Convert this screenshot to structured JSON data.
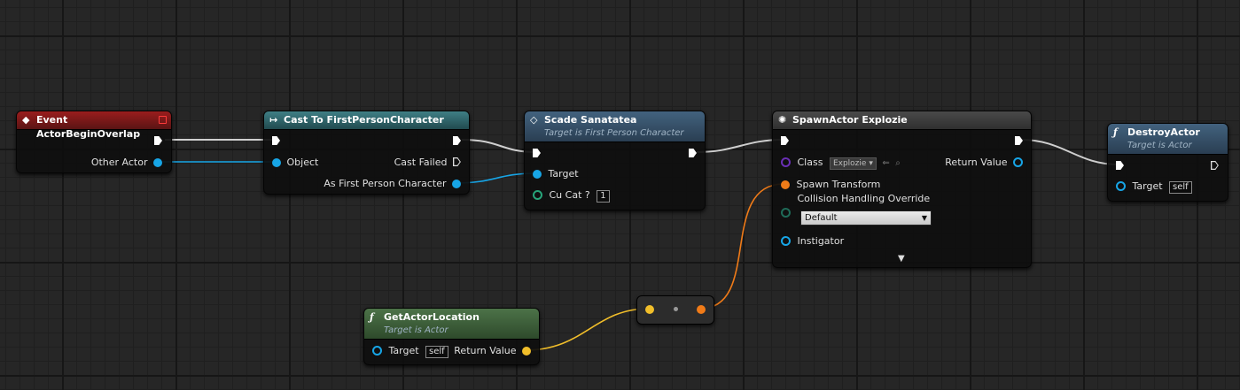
{
  "colors": {
    "exec": "#ffffff",
    "object": "#17a5e6",
    "vector": "#f1be2a",
    "transform": "#f07b18",
    "class": "#6a2fb5",
    "bool": "#27a57a",
    "wire_exec": "#cfcfcf"
  },
  "nodes": {
    "event_overlap": {
      "title": "Event ActorBeginOverlap",
      "icon": "event-diamond-icon",
      "pins": {
        "other_actor": "Other Actor"
      }
    },
    "cast": {
      "title": "Cast To FirstPersonCharacter",
      "icon": "cast-arrow-icon",
      "pins": {
        "object": "Object",
        "cast_failed": "Cast Failed",
        "as_fpc": "As First Person Character"
      }
    },
    "scade": {
      "title": "Scade Sanatatea",
      "subtitle": "Target is First Person Character",
      "icon": "function-diamond-icon",
      "pins": {
        "target": "Target",
        "cu_cat": "Cu Cat ?",
        "cu_cat_value": "1"
      }
    },
    "spawn": {
      "title": "SpawnActor Explozie",
      "icon": "spawn-actor-icon",
      "pins": {
        "class": "Class",
        "class_value": "Explozie",
        "return_value": "Return Value",
        "spawn_transform": "Spawn Transform",
        "collision": "Collision Handling Override",
        "collision_value": "Default",
        "instigator": "Instigator"
      }
    },
    "destroy": {
      "title": "DestroyActor",
      "subtitle": "Target is Actor",
      "icon": "function-f-icon",
      "pins": {
        "target": "Target",
        "target_value": "self"
      }
    },
    "get_location": {
      "title": "GetActorLocation",
      "subtitle": "Target is Actor",
      "icon": "function-f-icon",
      "pins": {
        "target": "Target",
        "target_value": "self",
        "return_value": "Return Value"
      }
    }
  }
}
